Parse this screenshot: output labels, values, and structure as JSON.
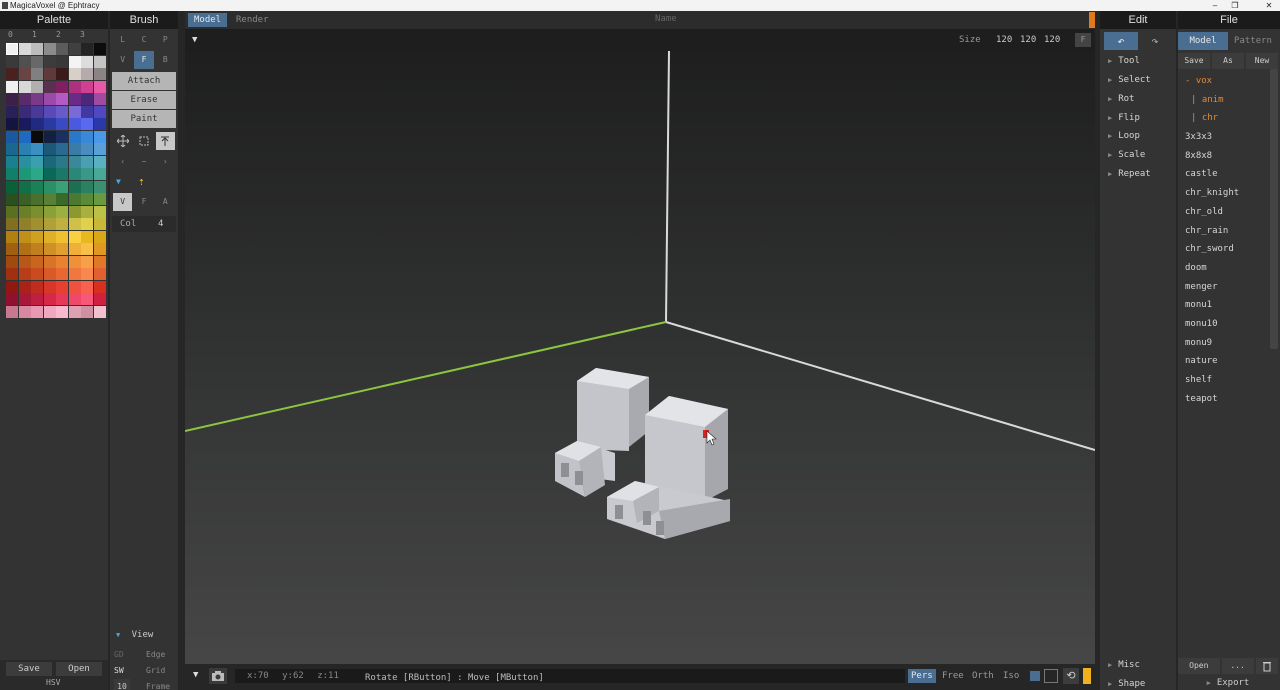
{
  "titlebar": {
    "title": "MagicaVoxel @ Ephtracy",
    "minimize": "–",
    "maximize": "❐",
    "close": "✕"
  },
  "palette": {
    "title": "Palette",
    "indices": [
      "0",
      "1",
      "2",
      "3"
    ],
    "save_label": "Save",
    "open_label": "Open",
    "mode_label": "HSV",
    "colors": [
      "#f0f0f0",
      "#d8d8d8",
      "#bcbcbc",
      "#8c8c8c",
      "#5c5c5c",
      "#404040",
      "#242424",
      "#0c0c0c",
      "#3a3a3a",
      "#505050",
      "#686868",
      "#3c3c3c",
      "#383838",
      "#f4f4f4",
      "#dcdcdc",
      "#c4c4c4",
      "#4a2020",
      "#6a4444",
      "#808080",
      "#5e3a3a",
      "#3a1a1a",
      "#d8d0c8",
      "#b4acac",
      "#8c8484",
      "#f0f0f0",
      "#d8d8d8",
      "#b0b0b0",
      "#5a3050",
      "#802060",
      "#b03080",
      "#d04090",
      "#e85aa8",
      "#3c2048",
      "#5a2a6a",
      "#7a3a8a",
      "#9a4aa8",
      "#b45ac4",
      "#6a2a88",
      "#4a2a78",
      "#a04aa0",
      "#2a2058",
      "#3a2a78",
      "#4a3a98",
      "#5a4ab8",
      "#6a5ac8",
      "#7a6ad8",
      "#403aa0",
      "#5048c0",
      "#141440",
      "#1a1a60",
      "#202a80",
      "#2a3aa0",
      "#3a4ac0",
      "#4a5ae0",
      "#5a6af0",
      "#2a38a8",
      "#1a58a0",
      "#1e6ac0",
      "#0a0a0a",
      "#142040",
      "#1a3060",
      "#2a78c8",
      "#3a88d8",
      "#4a98e8",
      "#1a6890",
      "#2a80b0",
      "#3a90c0",
      "#1e5878",
      "#2a6a90",
      "#3a7ca8",
      "#4a8cc0",
      "#5aa0d8",
      "#1a8090",
      "#2a90a0",
      "#3aa0b0",
      "#1a6878",
      "#2a7888",
      "#3a8898",
      "#4aa0b0",
      "#5ab0c0",
      "#10806a",
      "#1a9878",
      "#2aa888",
      "#0a6858",
      "#1a7868",
      "#2a8878",
      "#3a9888",
      "#4aa898",
      "#0a6038",
      "#107048",
      "#1a8058",
      "#2a9068",
      "#3aa078",
      "#1a7050",
      "#2a8060",
      "#3a9070",
      "#2a5020",
      "#3a6028",
      "#4a7030",
      "#5a8038",
      "#3a6a28",
      "#4a7a30",
      "#5a8a38",
      "#6a9a40",
      "#5a7020",
      "#6a8028",
      "#7a9030",
      "#8aa038",
      "#9ab040",
      "#8a9a30",
      "#aab040",
      "#bac048",
      "#807020",
      "#908028",
      "#a09030",
      "#b0a038",
      "#c0b040",
      "#d0c048",
      "#e0d050",
      "#c8b838",
      "#b08010",
      "#c09018",
      "#d0a020",
      "#e0b028",
      "#f0c030",
      "#f8d040",
      "#e8b820",
      "#d8a818",
      "#a06010",
      "#b07018",
      "#c08020",
      "#d09028",
      "#e0a030",
      "#f0b038",
      "#f8c048",
      "#e09820",
      "#a04a10",
      "#b85818",
      "#c86620",
      "#d87428",
      "#e88230",
      "#f09038",
      "#f8a048",
      "#e07828",
      "#a03010",
      "#b83e18",
      "#c84c20",
      "#d85a28",
      "#e86830",
      "#f07840",
      "#f88850",
      "#e06030",
      "#901810",
      "#a82218",
      "#c02c20",
      "#d83628",
      "#e84030",
      "#f05040",
      "#f86050",
      "#d83020",
      "#901030",
      "#a81838",
      "#c02040",
      "#d82848",
      "#e83858",
      "#f04868",
      "#f85878",
      "#d02040",
      "#c87890",
      "#d888a0",
      "#e898b0",
      "#f0a8c0",
      "#f8b8d0",
      "#e0a0b4",
      "#d090a4",
      "#f0c0cc"
    ]
  },
  "brush": {
    "title": "Brush",
    "row1": [
      "L",
      "C",
      "P"
    ],
    "row2": [
      "V",
      "F",
      "B"
    ],
    "modes": [
      "Attach",
      "Erase",
      "Paint"
    ],
    "row_vfa": [
      "V",
      "F",
      "A"
    ],
    "col_label": "Col",
    "col_value": "4",
    "view_label": "View",
    "view_rows": [
      [
        "GD",
        "Edge"
      ],
      [
        "SW",
        "Grid"
      ],
      [
        "10",
        "Frame"
      ]
    ]
  },
  "viewport": {
    "tabs": [
      "Model",
      "Render"
    ],
    "name_label": "Name",
    "size_label": "Size",
    "size_values": [
      "120",
      "120",
      "120"
    ],
    "f_button": "F",
    "coords": {
      "x": "x:70",
      "y": "y:62",
      "z": "z:11"
    },
    "projections": [
      "Pers",
      "Free",
      "Orth",
      "Iso"
    ],
    "hint": "Rotate [RButton] : Move [MButton]",
    "colors": {
      "x_axis": "#8cc63f",
      "axis": "#d9d9d9",
      "voxel": "#c9cacf",
      "cursor": "#d92020"
    }
  },
  "edit": {
    "title": "Edit",
    "undo": "↶",
    "redo": "↷",
    "items": [
      "Tool",
      "Select",
      "Rot",
      "Flip",
      "Loop",
      "Scale",
      "Repeat"
    ],
    "bottom_items": [
      "Misc",
      "Shape"
    ]
  },
  "file": {
    "title": "File",
    "tabs": [
      "Model",
      "Pattern"
    ],
    "actions": [
      "Save",
      "As",
      "New"
    ],
    "folders": [
      "- vox",
      "| anim",
      "| chr"
    ],
    "files": [
      "3x3x3",
      "8x8x8",
      "castle",
      "chr_knight",
      "chr_old",
      "chr_rain",
      "chr_sword",
      "doom",
      "menger",
      "monu1",
      "monu10",
      "monu9",
      "nature",
      "shelf",
      "teapot"
    ],
    "bottom": {
      "open": "Open",
      "more": "...",
      "delete_icon": "trash-icon",
      "export": "Export"
    }
  },
  "accent": "#4a6e92"
}
